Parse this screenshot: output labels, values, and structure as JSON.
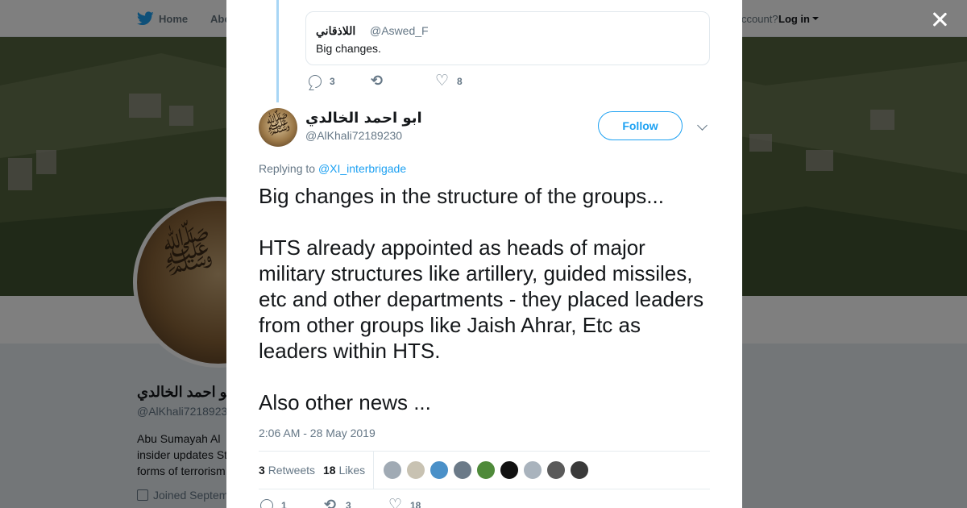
{
  "nav": {
    "home_label": "Home",
    "about_label": "Abo",
    "account_text": "ccount?",
    "login_label": "Log in"
  },
  "profile": {
    "name": "ابو احمد الخالدي",
    "handle": "@AlKhali7218923",
    "bio_lines": [
      "Abu Sumayah Al",
      "insider updates St",
      "forms of terrorism"
    ],
    "joined": "Joined Septem"
  },
  "quoted_tweet": {
    "name": "اللاذقاني",
    "handle": "@Aswed_F",
    "text": "Big changes."
  },
  "parent_actions": {
    "replies": "3",
    "retweets": "",
    "likes": "8"
  },
  "tweet": {
    "author_name": "ابو احمد الخالدي",
    "author_handle": "@AlKhali72189230",
    "follow_label": "Follow",
    "replying_prefix": "Replying to",
    "replying_to": "@XI_interbrigade",
    "text": "Big changes in the structure of the groups...\n\nHTS already appointed as heads of major military structures like artillery, guided missiles, etc and other departments - they placed leaders from other groups like Jaish Ahrar, Etc as leaders within HTS.\n\nAlso other news ...",
    "timestamp": "2:06 AM - 28 May 2019",
    "retweets_count": "3",
    "retweets_label": "Retweets",
    "likes_count": "18",
    "likes_label": "Likes",
    "replies": "1",
    "retweets_action": "3",
    "likes_action": "18"
  },
  "likers": [
    "#a0aab4",
    "#c8c2b2",
    "#4a90c8",
    "#6b7a88",
    "#4f8a3a",
    "#111111",
    "#a9b3bd",
    "#5a5a5a",
    "#3a3a3a"
  ],
  "colors": {
    "accent": "#1da1f2",
    "secondary_text": "#657786",
    "thread_line": "#a8d6f5"
  }
}
